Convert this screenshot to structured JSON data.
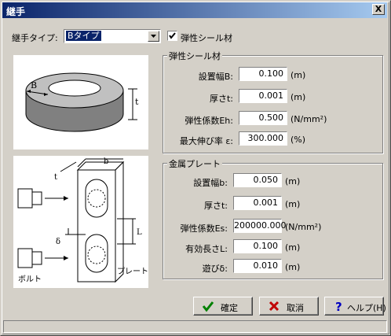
{
  "window": {
    "title": "継手",
    "close_label": "X"
  },
  "joint_type": {
    "label": "継手タイプ:",
    "selected": "Bタイプ"
  },
  "seal_checkbox": {
    "label": "弾性シール材",
    "checked": true
  },
  "seal_group": {
    "title": "弾性シール材",
    "fields": [
      {
        "label": "設置幅B:",
        "value": "0.100",
        "unit": "(m)"
      },
      {
        "label": "厚さt:",
        "value": "0.001",
        "unit": "(m)"
      },
      {
        "label": "弾性係数Eh:",
        "value": "0.500",
        "unit": "(N/mm²)"
      },
      {
        "label": "最大伸び率 ε:",
        "value": "300.000",
        "unit": "(%)"
      }
    ]
  },
  "plate_group": {
    "title": "金属プレート",
    "fields": [
      {
        "label": "設置幅b:",
        "value": "0.050",
        "unit": "(m)"
      },
      {
        "label": "厚さt:",
        "value": "0.001",
        "unit": "(m)"
      },
      {
        "label": "弾性係数Es:",
        "value": "200000.000",
        "unit": "(N/mm²)"
      },
      {
        "label": "有効長さL:",
        "value": "0.100",
        "unit": "(m)"
      },
      {
        "label": "遊びδ:",
        "value": "0.010",
        "unit": "(m)"
      }
    ]
  },
  "seal_diagram": {
    "label_b": "B",
    "label_t": "t"
  },
  "plate_diagram": {
    "label_b": "b",
    "label_t": "t",
    "label_l": "L",
    "label_delta": "δ",
    "label_bolt": "ボルト",
    "label_plate": "プレート"
  },
  "buttons": {
    "ok": "確定",
    "cancel": "取消",
    "help": "ヘルプ(H)"
  },
  "colors": {
    "title_bar_start": "#0a246a",
    "title_bar_end": "#a6caf0",
    "face": "#d4d0c8"
  },
  "icons": {
    "ok": "checkmark-icon",
    "cancel": "x-icon",
    "help": "question-icon"
  }
}
